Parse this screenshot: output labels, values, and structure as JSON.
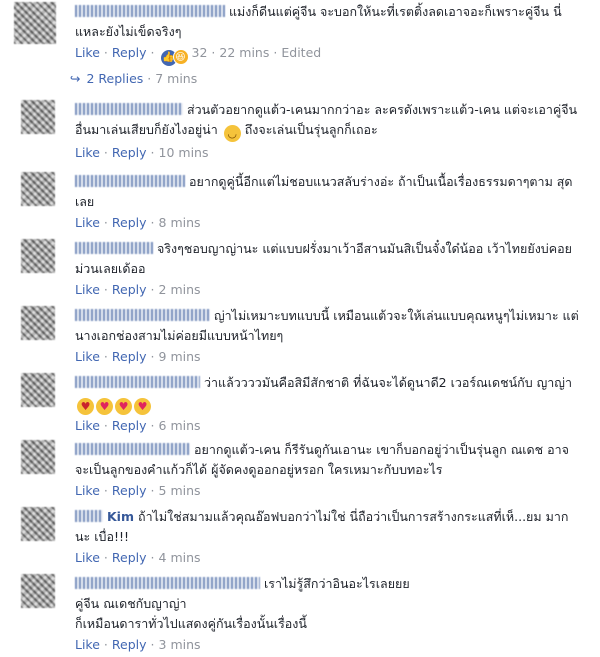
{
  "top_comment": {
    "text": "แม่งก็ดีนแต่คู่จีน จะบอกให้นะที่เรตติ้งลดเอาจอะก็เพราะคู่จีน นี่แหละยังไม่เข็ดจริงๆ",
    "like": "Like",
    "reply": "Reply",
    "reaction_count": "32",
    "time": "22 mins",
    "edited": "Edited"
  },
  "replies_toggle": {
    "label": "2 Replies",
    "time": "7 mins"
  },
  "comments": [
    {
      "text": "ส่วนตัวอยากดูแต้ว-เคนมากกว่าอะ ละครดังเพราะแต้ว-เคน แต่จะเอาคู่จีนอื่นมาเล่นเสียบก็ยังไงอยู่น่า",
      "tail": "ถึงจะเล่นเป็นรุ่นลูกก็เถอะ",
      "time": "10 mins"
    },
    {
      "text": "อยากดูคู่นี้อีกแต่ไม่ชอบแนวสลับร่างอ่ะ ถ้าเป็นเนื้อเรื่องธรรมดาๆตาม สุดเลย",
      "time": "8 mins"
    },
    {
      "text": "จริงๆชอบญาญ่านะ แต่แบบฝรั่งมาเว้าอีสานมันสิเป็นจั๋งใด๋น้ออ เว้าไทยยังบ่คอยม่วนเลยเด้ออ",
      "time": "2 mins"
    },
    {
      "text": "ญ่าไม่เหมาะบทแบบนี้ เหมือนแต้วจะให้เล่นแบบคุณหนูๆไม่เหมาะ แต่ นางเอกช่องสามไม่ค่อยมีแบบหน้าไทยๆ",
      "time": "9 mins"
    },
    {
      "text": "ว่าแล้ววววมันคือสิมีสักชาติ ที่ฉันจะได้ดูนาดี2 เวอร์ณเดชน์กับ ญาญ่า",
      "time": "6 mins"
    },
    {
      "text": "อยากดูแต้ว-เคน ก็รีรันดูกันเอานะ เขาก็บอกอยู่ว่าเป็นรุ่นลูก ณเดช อาจจะเป็นลูกของคำแก้วก็ได้ ผู้จัดคงดูออกอยู่หรอก ใครเหมาะกับบทอะไร",
      "time": "5 mins"
    },
    {
      "name_short": "Kim",
      "text": "ถ้าไม่ใช่สมามแล้วคุณอ๊อฟบอกว่าไม่ใช่ นี่ถือว่าเป็นการสร้างกระแสที่เห็...ยม มากนะ เบื่อ!!!",
      "time": "4 mins"
    },
    {
      "text": "เราไม่รู้สึกว่าอินอะไรเลยยย",
      "line2": "คู่จีน ณเดชกับญาญ่า",
      "line3": "ก็เหมือนดาราทั่วไปแสดงคู่กันเรื่องนั้นเรื่องนี้",
      "time": "3 mins"
    }
  ],
  "labels": {
    "like": "Like",
    "reply": "Reply"
  }
}
